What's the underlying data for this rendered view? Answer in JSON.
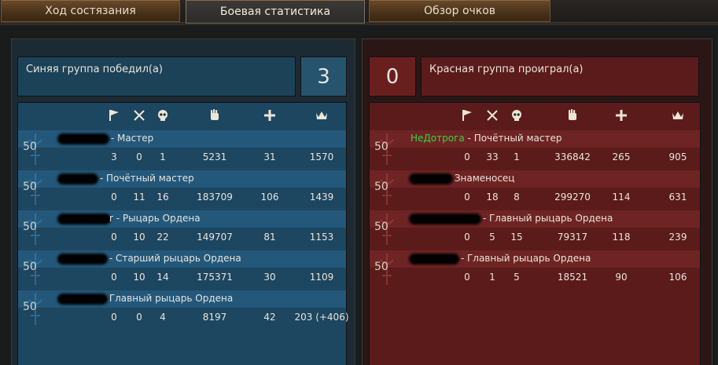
{
  "tabs": [
    {
      "label": "Ход состязания",
      "active": false
    },
    {
      "label": "Боевая статистика",
      "active": true
    },
    {
      "label": "Обзор очков",
      "active": false
    }
  ],
  "blue_team": {
    "result_text": "Синяя группа победил(а)",
    "score": "3",
    "players": [
      {
        "level": "50",
        "name_visible": "",
        "rank": "- Мастер",
        "stats": [
          "3",
          "0",
          "1",
          "5231",
          "31",
          "1570"
        ]
      },
      {
        "level": "50",
        "name_visible": "",
        "rank": "- Почётный мастер",
        "stats": [
          "0",
          "11",
          "16",
          "183709",
          "106",
          "1439"
        ]
      },
      {
        "level": "50",
        "name_visible": "r",
        "rank": "- Рыцарь Ордена",
        "stats": [
          "0",
          "10",
          "22",
          "149707",
          "81",
          "1153"
        ]
      },
      {
        "level": "50",
        "name_visible": "",
        "rank": "- Старший рыцарь Ордена",
        "stats": [
          "0",
          "10",
          "14",
          "175371",
          "30",
          "1109"
        ]
      },
      {
        "level": "50",
        "name_visible": "",
        "rank": "Главный рыцарь Ордена",
        "stats": [
          "0",
          "0",
          "4",
          "8197",
          "42",
          "203 (+406)"
        ]
      }
    ]
  },
  "red_team": {
    "result_text": "Красная группа проиграл(а)",
    "score": "0",
    "players": [
      {
        "level": "50",
        "name_visible": "НеДотрога",
        "rank": "- Почётный мастер",
        "stats": [
          "0",
          "33",
          "1",
          "336842",
          "265",
          "905"
        ]
      },
      {
        "level": "50",
        "name_visible": "",
        "rank": "Знаменосец",
        "stats": [
          "0",
          "18",
          "8",
          "299270",
          "114",
          "631"
        ]
      },
      {
        "level": "50",
        "name_visible": "",
        "rank": "- Главный рыцарь Ордена",
        "stats": [
          "0",
          "5",
          "15",
          "79317",
          "118",
          "239"
        ]
      },
      {
        "level": "50",
        "name_visible": "",
        "rank": "- Главный рыцарь Ордена",
        "stats": [
          "0",
          "1",
          "5",
          "18521",
          "90",
          "106"
        ]
      }
    ]
  },
  "columns": [
    {
      "icon": "flag-icon"
    },
    {
      "icon": "crossed-swords-icon"
    },
    {
      "icon": "skull-icon"
    },
    {
      "icon": "fist-icon"
    },
    {
      "icon": "plus-icon"
    },
    {
      "icon": "crown-icon"
    }
  ],
  "colors": {
    "blue_panel": "#1d4660",
    "blue_row": "#23587a",
    "red_panel": "#5b1b1b",
    "red_row": "#6e2424",
    "highlight_name": "#39d339"
  }
}
